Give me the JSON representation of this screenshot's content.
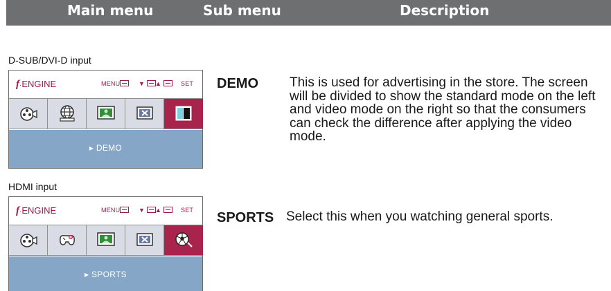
{
  "header": {
    "main_menu": "Main menu",
    "sub_menu": "Sub menu",
    "description": "Description"
  },
  "sections": [
    {
      "input_label": "D-SUB/DVI-D input",
      "osd": {
        "brand_f": "f",
        "brand_dot": "·",
        "brand_name": "ENGINE",
        "menu_label": "MENU",
        "set_label": "SET",
        "icons": [
          "movie-reel-icon",
          "internet-globe-icon",
          "picture-icon",
          "user-cancel-icon",
          "demo-split-icon"
        ],
        "active_index": 4,
        "mode_text": "▸ DEMO"
      },
      "term": "DEMO",
      "description": "This is used for advertising in the store. The screen will be divided to show the standard mode on the left and video mode on the right so that the consumers can check the difference after applying the video mode."
    },
    {
      "input_label": "HDMI input",
      "osd": {
        "brand_f": "f",
        "brand_dot": "·",
        "brand_name": "ENGINE",
        "menu_label": "MENU",
        "set_label": "SET",
        "icons": [
          "movie-reel-icon",
          "game-controller-icon",
          "picture-icon",
          "user-cancel-icon",
          "soccer-ball-icon"
        ],
        "active_index": 4,
        "mode_text": "▸ SPORTS"
      },
      "term": "SPORTS",
      "description": "Select this when you watching general sports."
    }
  ]
}
